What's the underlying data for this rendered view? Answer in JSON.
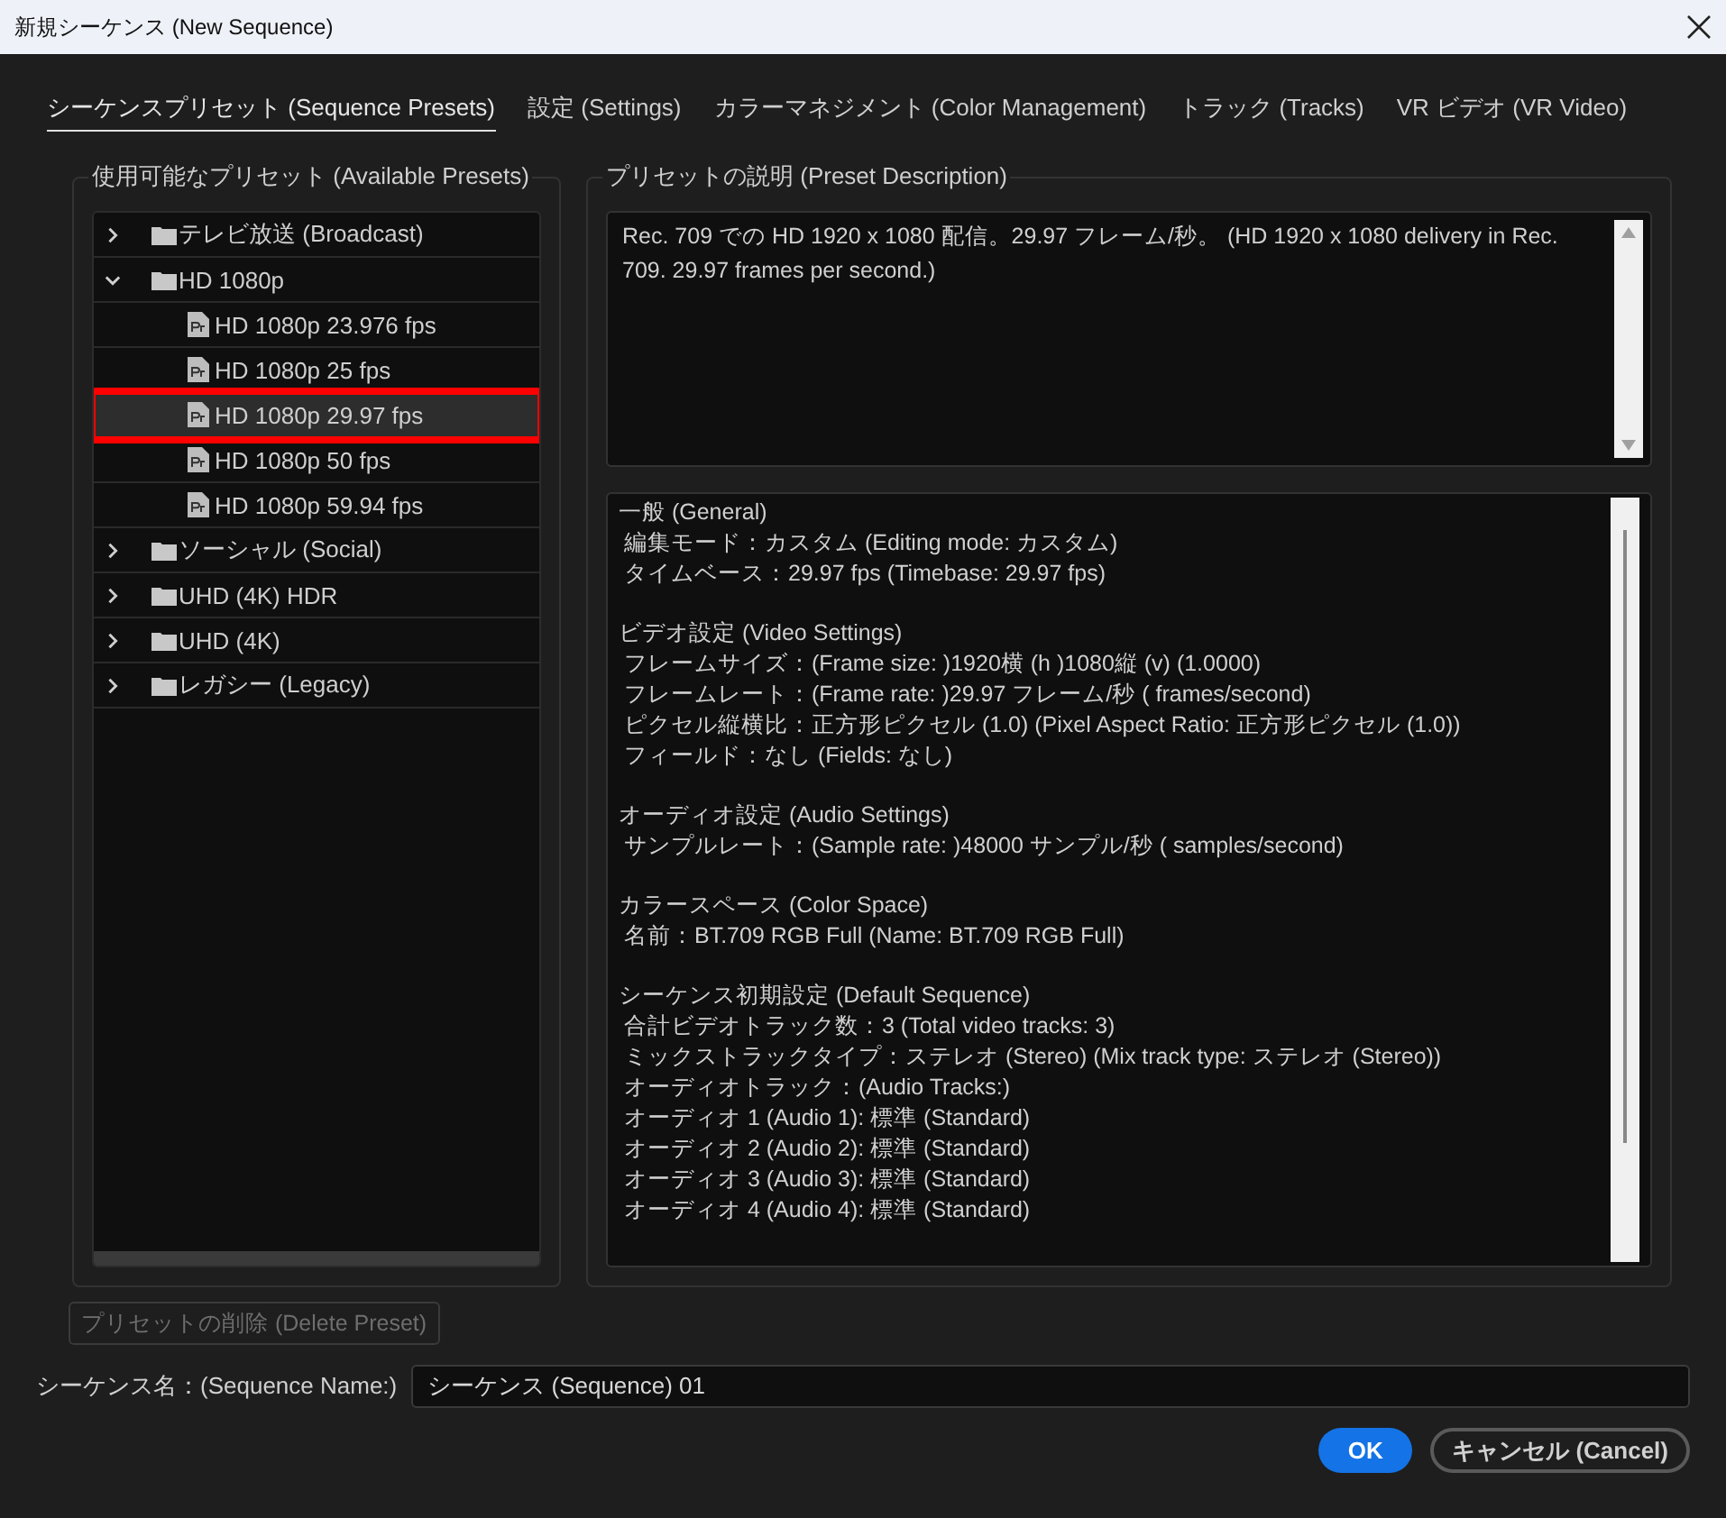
{
  "window": {
    "title": "新規シーケンス (New Sequence)"
  },
  "tabs": [
    {
      "label": "シーケンスプリセット (Sequence Presets)",
      "selected": true
    },
    {
      "label": "設定 (Settings)",
      "selected": false
    },
    {
      "label": "カラーマネジメント (Color Management)",
      "selected": false
    },
    {
      "label": "トラック (Tracks)",
      "selected": false
    },
    {
      "label": "VR ビデオ (VR Video)",
      "selected": false
    }
  ],
  "presets": {
    "title": "使用可能なプリセット (Available Presets)",
    "items": [
      {
        "kind": "folder",
        "label": "テレビ放送 (Broadcast)",
        "expanded": false,
        "selected": false,
        "annotated": false
      },
      {
        "kind": "folder",
        "label": "HD 1080p",
        "expanded": true,
        "selected": false,
        "annotated": false,
        "children": [
          {
            "kind": "preset",
            "label": "HD 1080p 23.976 fps",
            "selected": false,
            "annotated": false
          },
          {
            "kind": "preset",
            "label": "HD 1080p 25 fps",
            "selected": false,
            "annotated": false
          },
          {
            "kind": "preset",
            "label": "HD 1080p 29.97 fps",
            "selected": true,
            "annotated": true
          },
          {
            "kind": "preset",
            "label": "HD 1080p 50 fps",
            "selected": false,
            "annotated": false
          },
          {
            "kind": "preset",
            "label": "HD 1080p 59.94 fps",
            "selected": false,
            "annotated": false
          }
        ]
      },
      {
        "kind": "folder",
        "label": "ソーシャル (Social)",
        "expanded": false,
        "selected": false,
        "annotated": false
      },
      {
        "kind": "folder",
        "label": "UHD (4K) HDR",
        "expanded": false,
        "selected": false,
        "annotated": false
      },
      {
        "kind": "folder",
        "label": "UHD (4K)",
        "expanded": false,
        "selected": false,
        "annotated": false
      },
      {
        "kind": "folder",
        "label": "レガシー (Legacy)",
        "expanded": false,
        "selected": false,
        "annotated": false
      }
    ],
    "delete_button": {
      "label": "プリセットの削除 (Delete Preset)",
      "disabled": true
    }
  },
  "description": {
    "title": "プリセットの説明 (Preset Description)",
    "text": "Rec. 709 での HD 1920 x 1080 配信。29.97 フレーム/秒。 (HD 1920 x 1080 delivery in Rec. 709. 29.97 frames per second.)",
    "sections": [
      {
        "heading": "一般 (General)",
        "lines": [
          "編集モード：カスタム (Editing mode: カスタム)",
          "タイムベース：29.97 fps (Timebase: 29.97 fps)"
        ]
      },
      {
        "heading": "ビデオ設定 (Video Settings)",
        "lines": [
          "フレームサイズ：(Frame size: )1920横 (h )1080縦 (v) (1.0000)",
          "フレームレート：(Frame rate: )29.97  フレーム/秒 ( frames/second)",
          "ピクセル縦横比：正方形ピクセル (1.0) (Pixel Aspect Ratio: 正方形ピクセル (1.0))",
          "フィールド：なし (Fields: なし)"
        ]
      },
      {
        "heading": "オーディオ設定 (Audio Settings)",
        "lines": [
          "サンプルレート：(Sample rate: )48000 サンプル/秒 ( samples/second)"
        ]
      },
      {
        "heading": "カラースペース (Color Space)",
        "lines": [
          "名前：BT.709 RGB Full (Name: BT.709 RGB Full)"
        ]
      },
      {
        "heading": "シーケンス初期設定 (Default Sequence)",
        "lines": [
          "合計ビデオトラック数：3 (Total video tracks: 3)",
          "ミックストラックタイプ：ステレオ (Stereo) (Mix track type: ステレオ (Stereo))",
          "オーディオトラック：(Audio Tracks:)",
          "オーディオ 1 (Audio 1): 標準 (Standard)",
          "オーディオ 2 (Audio 2): 標準 (Standard)",
          "オーディオ 3 (Audio 3): 標準 (Standard)",
          "オーディオ 4 (Audio 4): 標準 (Standard)"
        ]
      }
    ]
  },
  "sequence_name": {
    "label": "シーケンス名：(Sequence Name:)",
    "value": "シーケンス (Sequence) 01"
  },
  "buttons": [
    {
      "kind": "primary",
      "label": "OK"
    },
    {
      "kind": "secondary",
      "label": "キャンセル (Cancel)"
    }
  ]
}
